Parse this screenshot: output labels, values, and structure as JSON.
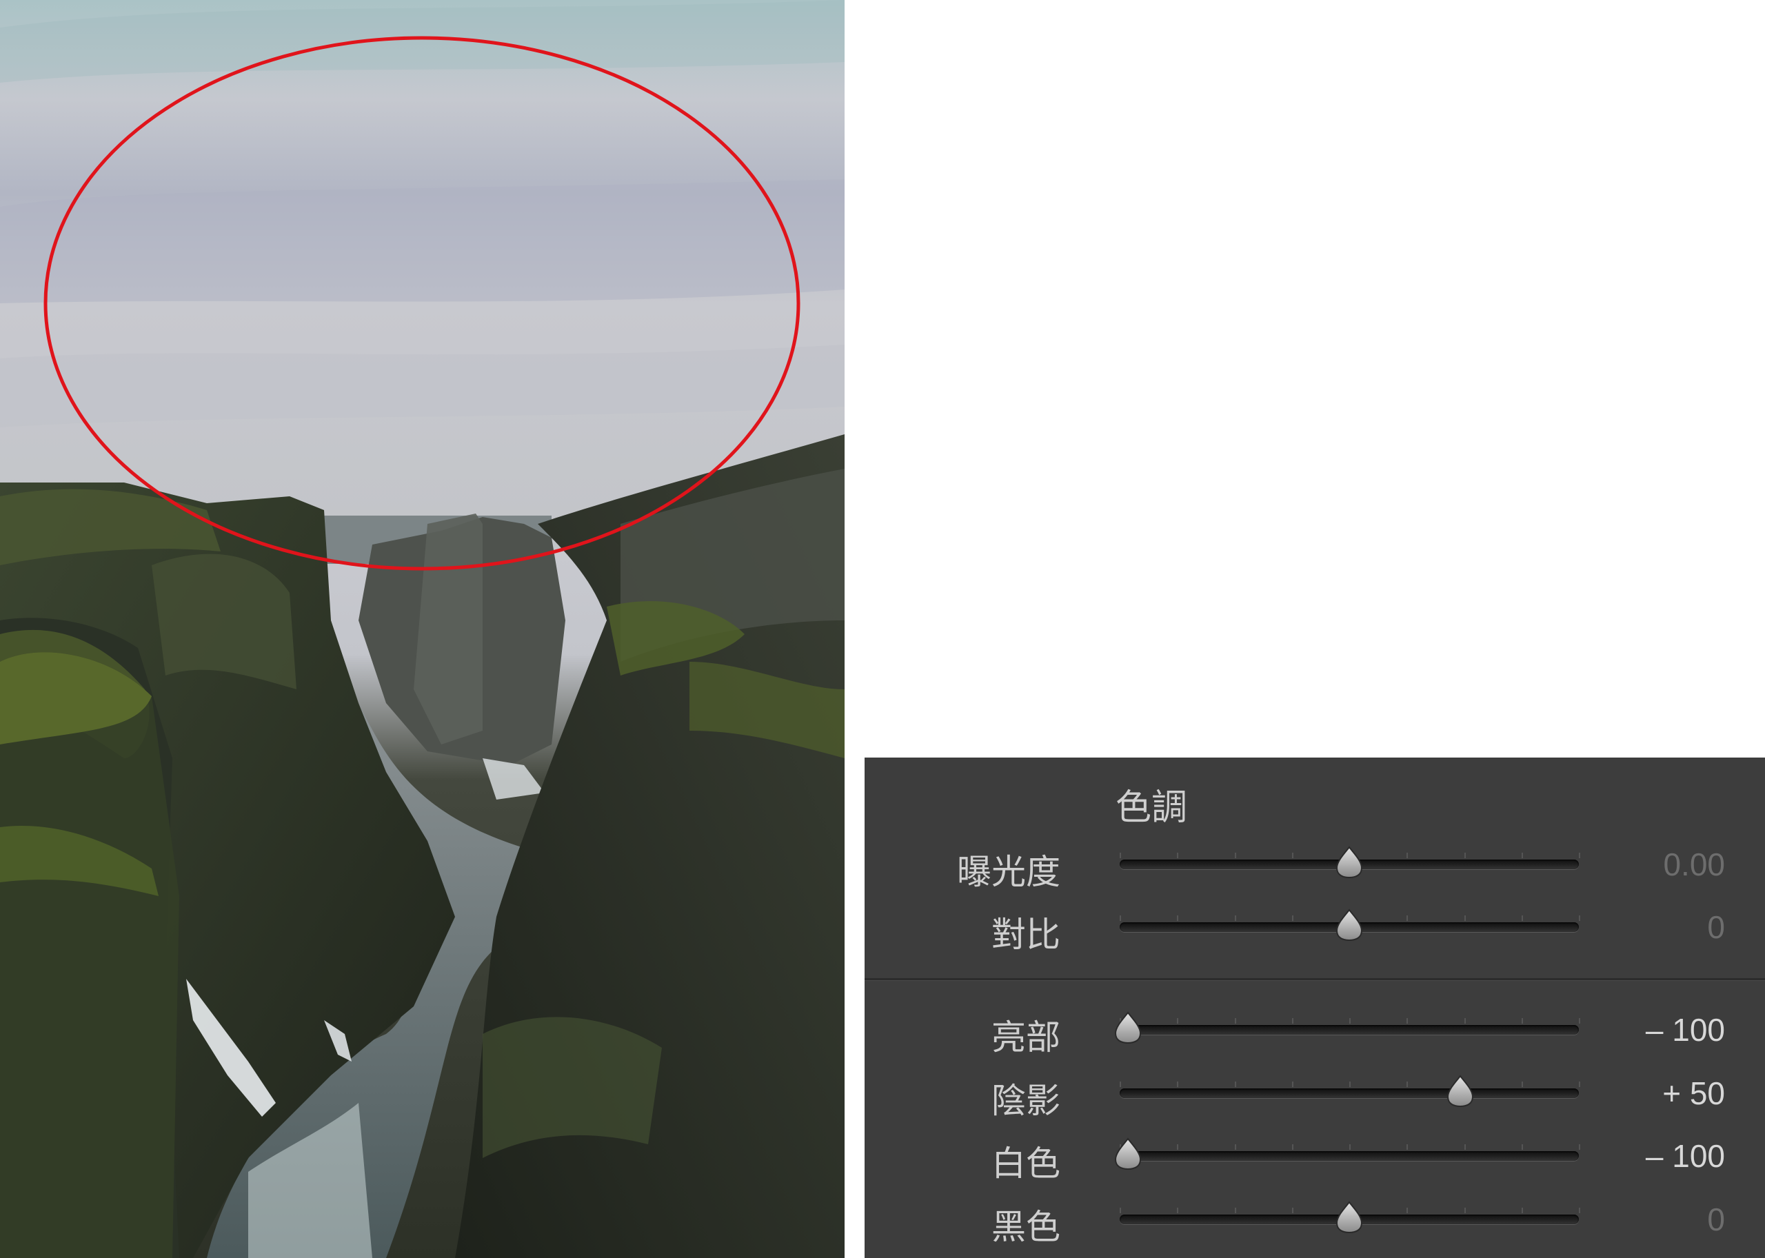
{
  "panel": {
    "title": "色調",
    "sliders": [
      {
        "id": "exposure",
        "label": "曝光度",
        "value_text": "0.00",
        "value": 0,
        "min": -5,
        "max": 5,
        "dim": true
      },
      {
        "id": "contrast",
        "label": "對比",
        "value_text": "0",
        "value": 0,
        "min": -100,
        "max": 100,
        "dim": true
      },
      {
        "id": "highlights",
        "label": "亮部",
        "value_text": "– 100",
        "value": -100,
        "min": -100,
        "max": 100,
        "dim": false
      },
      {
        "id": "shadows",
        "label": "陰影",
        "value_text": "+ 50",
        "value": 50,
        "min": -100,
        "max": 100,
        "dim": false
      },
      {
        "id": "whites",
        "label": "白色",
        "value_text": "– 100",
        "value": -100,
        "min": -100,
        "max": 100,
        "dim": false
      },
      {
        "id": "blacks",
        "label": "黑色",
        "value_text": "0",
        "value": 0,
        "min": -100,
        "max": 100,
        "dim": true
      }
    ]
  },
  "colors": {
    "panel_bg": "#3d3d3d",
    "highlight_ellipse": "#e0141b"
  }
}
